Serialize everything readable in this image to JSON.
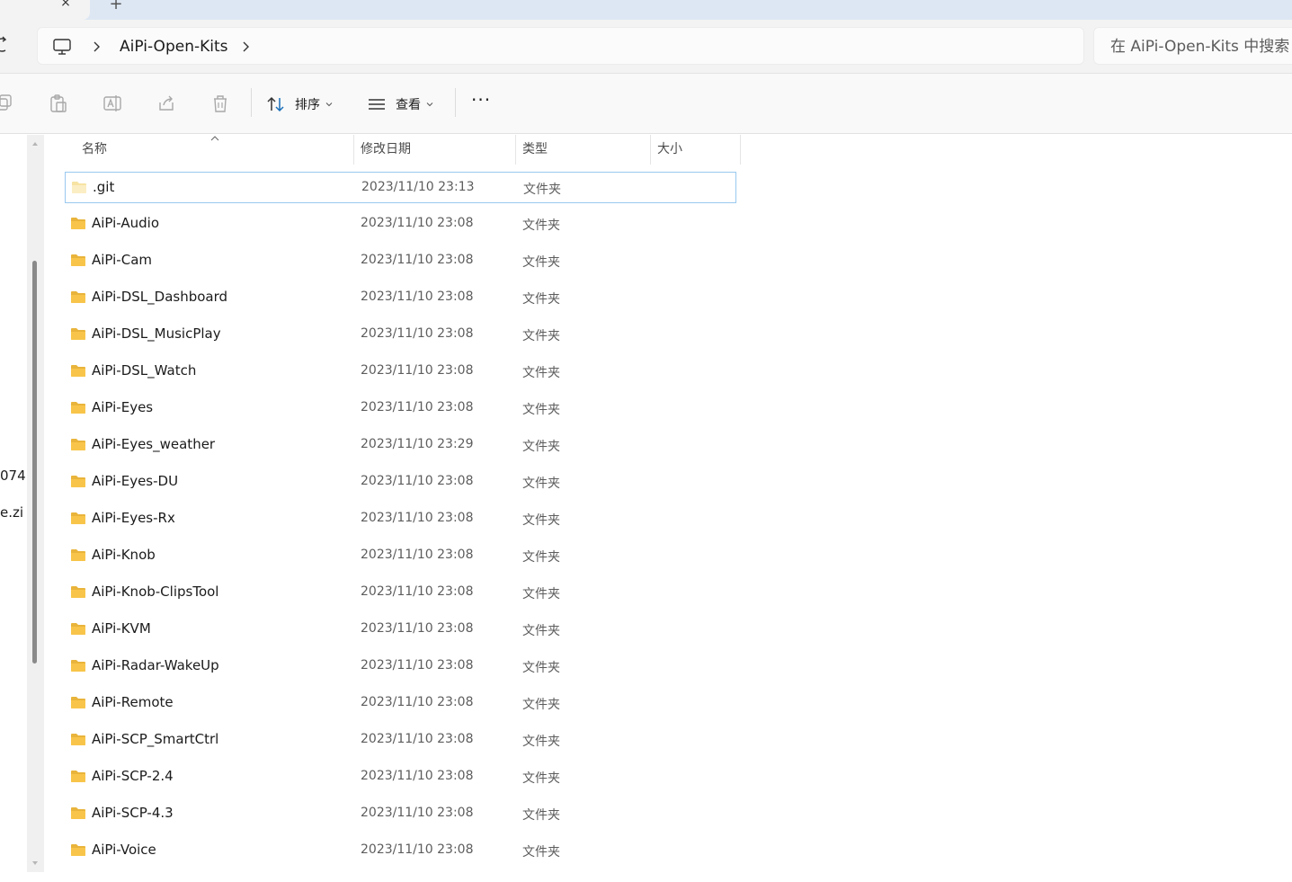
{
  "window": {
    "new_tab_label": "+",
    "close_tab_label": "×"
  },
  "address": {
    "breadcrumb": [
      "AiPi-Open-Kits"
    ],
    "search_placeholder": "在 AiPi-Open-Kits 中搜索"
  },
  "toolbar": {
    "sort_label": "排序",
    "view_label": "查看",
    "more_label": "···"
  },
  "nav": {
    "items": [
      "074",
      "e.zi"
    ]
  },
  "columns": {
    "name": "名称",
    "modified": "修改日期",
    "type": "类型",
    "size": "大小"
  },
  "files": [
    {
      "name": ".git",
      "modified": "2023/11/10 23:13",
      "type": "文件夹",
      "selected": true,
      "icon": "folder-light-icon"
    },
    {
      "name": "AiPi-Audio",
      "modified": "2023/11/10 23:08",
      "type": "文件夹"
    },
    {
      "name": "AiPi-Cam",
      "modified": "2023/11/10 23:08",
      "type": "文件夹"
    },
    {
      "name": "AiPi-DSL_Dashboard",
      "modified": "2023/11/10 23:08",
      "type": "文件夹"
    },
    {
      "name": "AiPi-DSL_MusicPlay",
      "modified": "2023/11/10 23:08",
      "type": "文件夹"
    },
    {
      "name": "AiPi-DSL_Watch",
      "modified": "2023/11/10 23:08",
      "type": "文件夹"
    },
    {
      "name": "AiPi-Eyes",
      "modified": "2023/11/10 23:08",
      "type": "文件夹"
    },
    {
      "name": "AiPi-Eyes_weather",
      "modified": "2023/11/10 23:29",
      "type": "文件夹"
    },
    {
      "name": "AiPi-Eyes-DU",
      "modified": "2023/11/10 23:08",
      "type": "文件夹"
    },
    {
      "name": "AiPi-Eyes-Rx",
      "modified": "2023/11/10 23:08",
      "type": "文件夹"
    },
    {
      "name": "AiPi-Knob",
      "modified": "2023/11/10 23:08",
      "type": "文件夹"
    },
    {
      "name": "AiPi-Knob-ClipsTool",
      "modified": "2023/11/10 23:08",
      "type": "文件夹"
    },
    {
      "name": "AiPi-KVM",
      "modified": "2023/11/10 23:08",
      "type": "文件夹"
    },
    {
      "name": "AiPi-Radar-WakeUp",
      "modified": "2023/11/10 23:08",
      "type": "文件夹"
    },
    {
      "name": "AiPi-Remote",
      "modified": "2023/11/10 23:08",
      "type": "文件夹"
    },
    {
      "name": "AiPi-SCP_SmartCtrl",
      "modified": "2023/11/10 23:08",
      "type": "文件夹"
    },
    {
      "name": "AiPi-SCP-2.4",
      "modified": "2023/11/10 23:08",
      "type": "文件夹"
    },
    {
      "name": "AiPi-SCP-4.3",
      "modified": "2023/11/10 23:08",
      "type": "文件夹"
    },
    {
      "name": "AiPi-Voice",
      "modified": "2023/11/10 23:08",
      "type": "文件夹"
    }
  ],
  "colors": {
    "selection_border": "#99c9ef",
    "folder_yellow": "#f8c54a",
    "tabstrip": "#dde7f3"
  }
}
